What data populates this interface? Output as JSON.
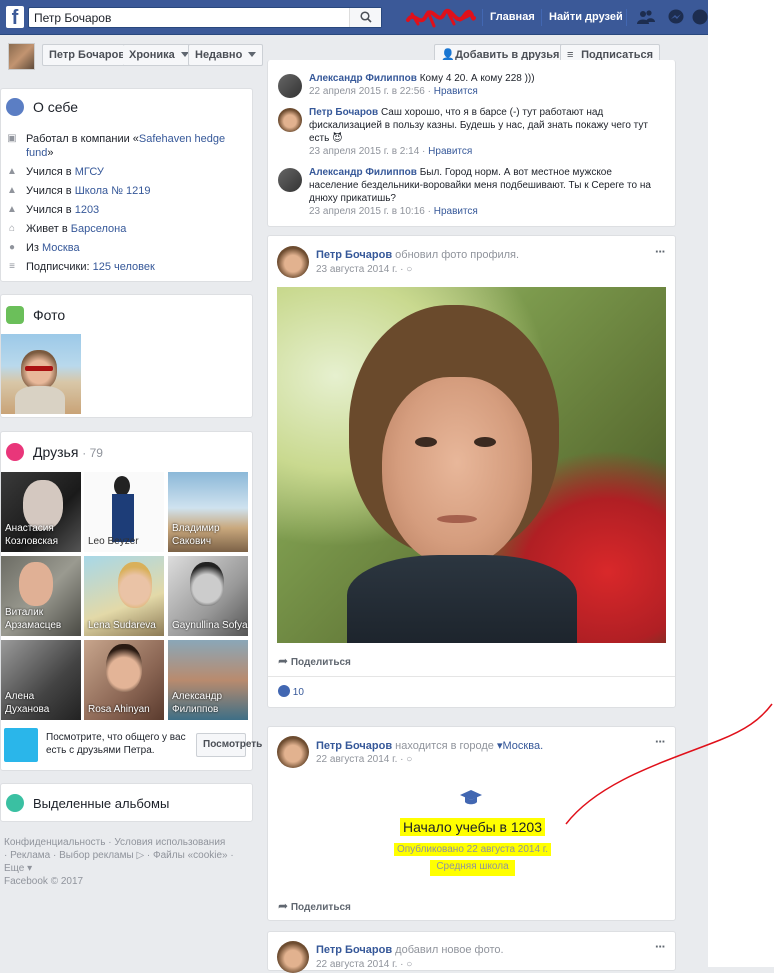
{
  "topbar": {
    "search_value": "Петр Бочаров",
    "nav_home": "Главная",
    "nav_find_friends": "Найти друзей"
  },
  "profile_bar": {
    "name_button": "Петр Бочаров",
    "timeline_button": "Хроника",
    "recent_button": "Недавно",
    "add_friend_button": "Добавить в друзья",
    "subscribe_button": "Подписаться"
  },
  "about": {
    "title": "О себе",
    "work_prefix": "Работал в компании «",
    "work_company": "Safehaven hedge fund",
    "work_suffix": "»",
    "studied1_prefix": "Учился в ",
    "studied1_place": "МГСУ",
    "studied2_prefix": "Учился в ",
    "studied2_place": "Школа № 1219",
    "studied3_prefix": "Учился в ",
    "studied3_place": "1203",
    "lives_prefix": "Живет в ",
    "lives_place": "Барселона",
    "from_prefix": "Из ",
    "from_place": "Москва",
    "followers_prefix": "Подписчики: ",
    "followers_count": "125 человек"
  },
  "photos": {
    "title": "Фото"
  },
  "friends": {
    "title": "Друзья",
    "count": "· 79",
    "items": [
      {
        "name": "Анастасия Козловская"
      },
      {
        "name": "Leo Beyzer"
      },
      {
        "name": "Владимир Сакович"
      },
      {
        "name": "Виталик Арзамасцев"
      },
      {
        "name": "Lena Sudareva"
      },
      {
        "name": "Gaynullina Sofya"
      },
      {
        "name": "Алена Духанова"
      },
      {
        "name": "Rosa Ahinyan"
      },
      {
        "name": "Александр Филиппов"
      }
    ],
    "common_text": "Посмотрите, что общего у вас есть с друзьями Петра.",
    "common_button": "Посмотреть"
  },
  "albums": {
    "title": "Выделенные альбомы"
  },
  "footer": {
    "line1": "Конфиденциальность · Условия использования",
    "line2": "· Реклама · Выбор рекламы ▷ · Файлы «cookie» ·",
    "line3": "Еще ▾",
    "line4": "Facebook © 2017"
  },
  "comments": [
    {
      "author": "Александр Филиппов",
      "text": " Кому 4 20. А кому 228 )))",
      "time": "22 апреля 2015 г. в 22:56",
      "like": "Нравится"
    },
    {
      "author": "Петр Бочаров",
      "text": " Саш хорошо, что я в барсе (-) тут работают над фискализацией в пользу казны. Будешь у нас, дай знать покажу чего тут есть 😈",
      "time": "23 апреля 2015 г. в 2:14",
      "like": "Нравится"
    },
    {
      "author": "Александр Филиппов",
      "text": " Был. Город норм. А вот местное мужское население бездельники-воровайки меня подбешивают. Ты к Сереге то на днюху прикатишь?",
      "time": "23 апреля 2015 г. в 10:16",
      "like": "Нравится"
    }
  ],
  "post1": {
    "author": "Петр Бочаров",
    "action": " обновил фото профиля.",
    "time": "23 августа 2014 г. ·",
    "share": "Поделиться",
    "likes": "10"
  },
  "post2": {
    "author": "Петр Бочаров",
    "action": " находится в городе ",
    "place": "Москва.",
    "time": "22 августа 2014 г. ·",
    "event_title": "Начало учебы в 1203",
    "event_published": "Опубликовано 22 августа 2014 г.",
    "event_type": "Средняя школа",
    "share": "Поделиться"
  },
  "post3": {
    "author": "Петр Бочаров",
    "action": " добавил новое фото.",
    "time": "22 августа 2014 г. ·"
  },
  "colors": {
    "brand": "#3b5998",
    "link": "#365899",
    "highlight": "#ffff00",
    "annotation": "#e0101a"
  }
}
